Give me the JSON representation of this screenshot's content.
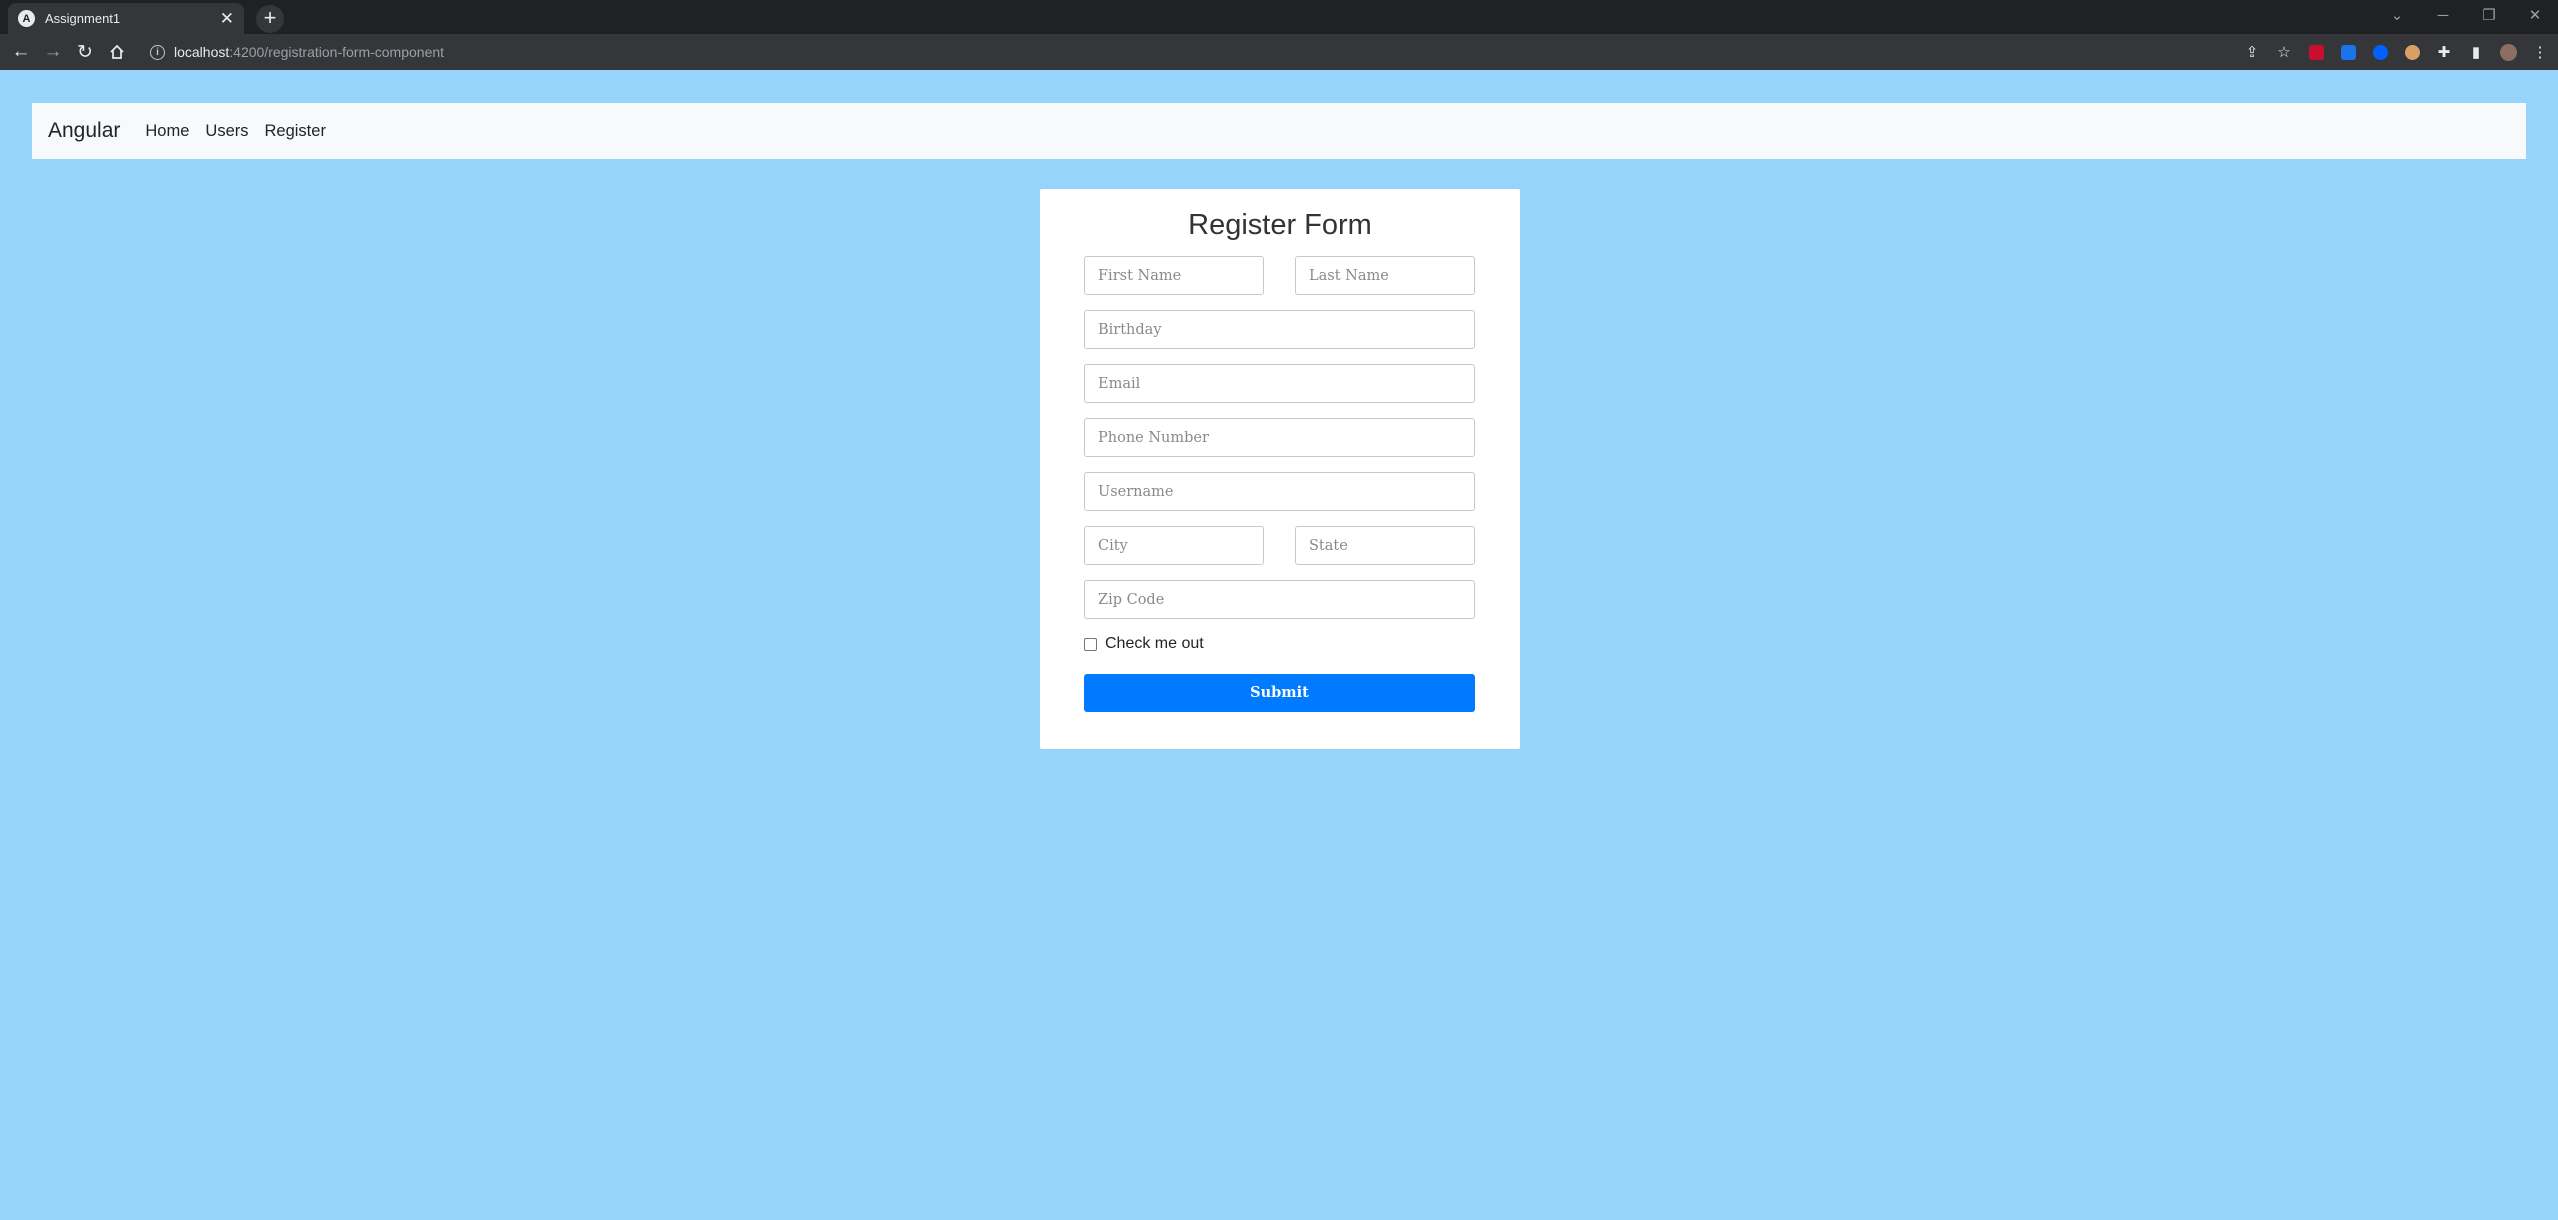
{
  "browser": {
    "tab_title": "Assignment1",
    "tab_favicon": "A",
    "close_glyph": "✕",
    "new_tab_glyph": "+",
    "url_host": "localhost",
    "url_path": ":4200/registration-form-component",
    "icons": [
      "back-icon",
      "forward-icon",
      "reload-icon",
      "home-icon",
      "info-icon",
      "share-icon",
      "star-icon",
      "ublock-icon",
      "download-extension-icon",
      "dropbox-extension-icon",
      "cookie-extension-icon",
      "puzzle-icon",
      "side-panel-icon",
      "profile-avatar",
      "kebab-menu-icon"
    ],
    "extension_colors": {
      "ublock": "#c8102e",
      "download": "#1a73e8",
      "dropbox": "#0061fe",
      "cookie": "#d9a066"
    }
  },
  "navbar": {
    "brand": "Angular",
    "links": [
      "Home",
      "Users",
      "Register"
    ],
    "background": "#f8f9fa"
  },
  "form": {
    "title": "Register Form",
    "fields": {
      "first_name": "First Name",
      "last_name": "Last Name",
      "birthday": "Birthday",
      "email": "Email",
      "phone": "Phone Number",
      "username": "Username",
      "city": "City",
      "state": "State",
      "zip": "Zip Code"
    },
    "checkbox_label": "Check me out",
    "checkbox_checked": false,
    "submit_label": "Submit",
    "submit_color": "#007bff"
  },
  "page_background": "#97d4fc"
}
